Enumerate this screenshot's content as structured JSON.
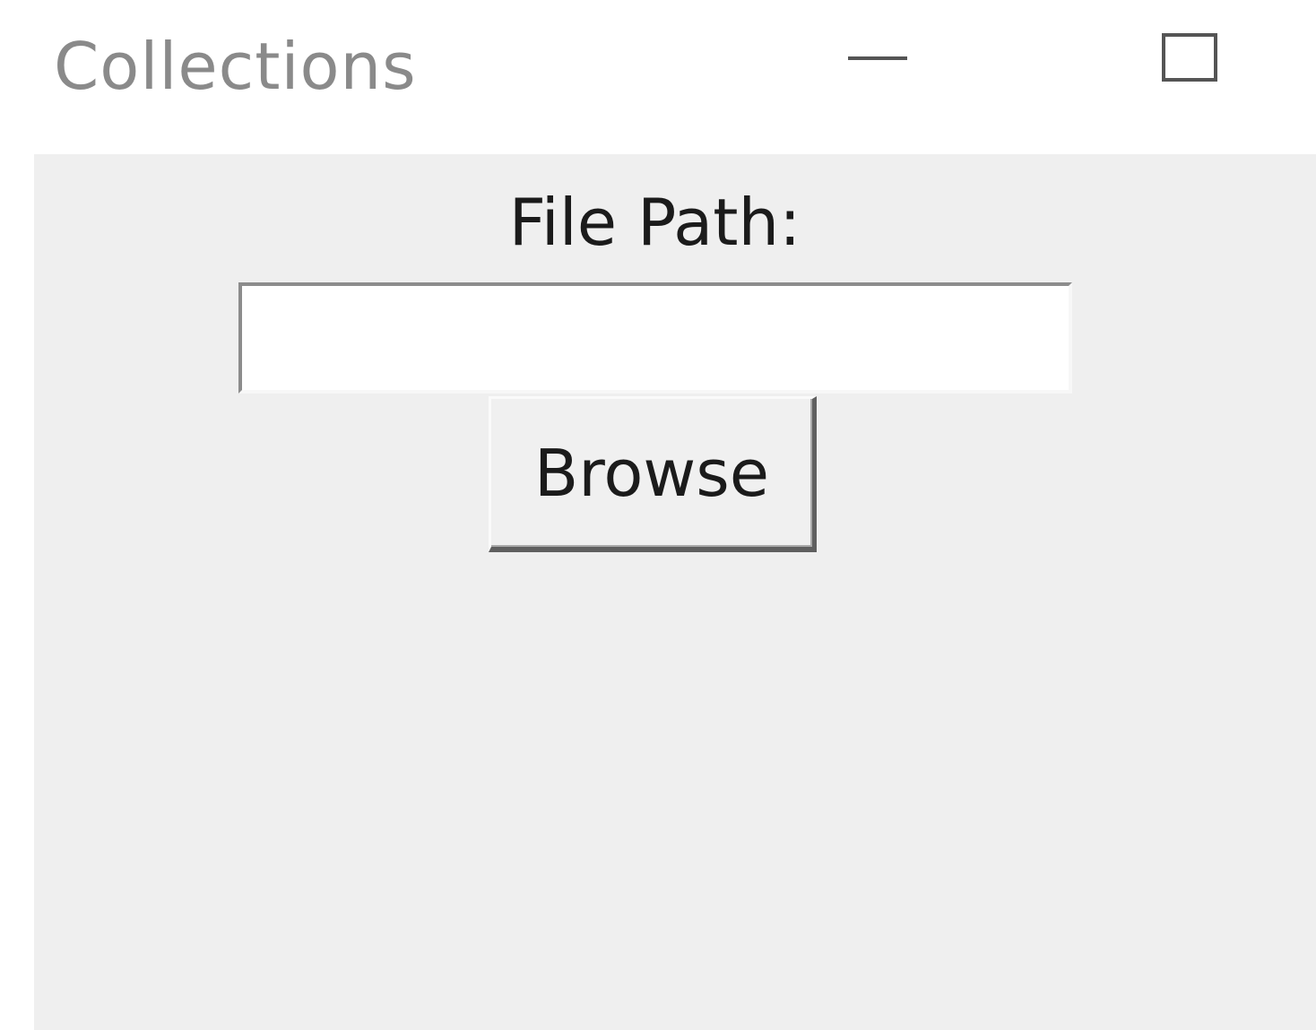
{
  "window": {
    "title": "Collections",
    "controls": {
      "minimize": "minimize-icon",
      "maximize": "maximize-icon"
    }
  },
  "form": {
    "file_path_label": "File Path:",
    "file_path_value": "",
    "browse_button_label": "Browse"
  },
  "colors": {
    "title_text": "#8a8a8a",
    "client_background": "#efefef",
    "input_background": "#ffffff"
  }
}
